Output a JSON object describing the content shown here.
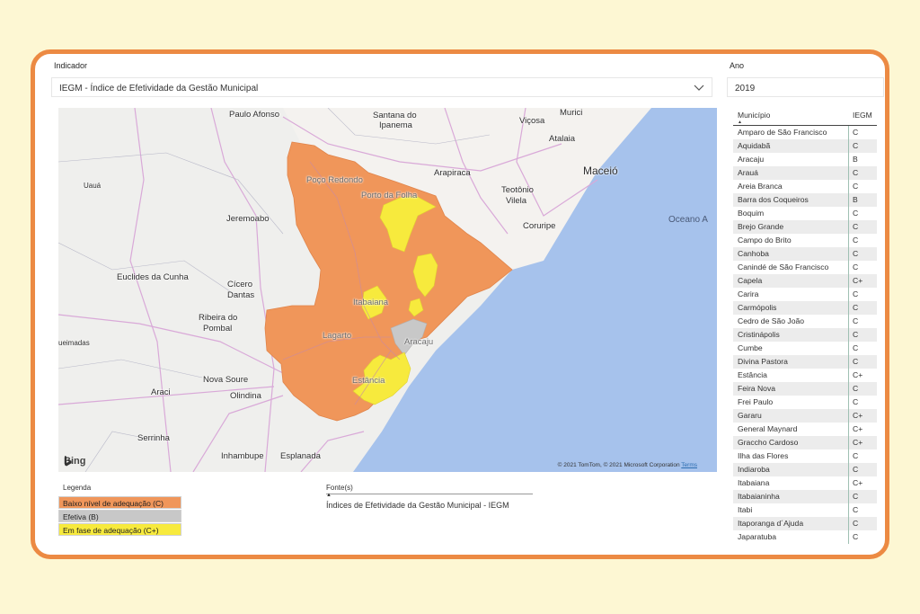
{
  "filters": {
    "indicator_label": "Indicador",
    "indicator_value": "IEGM - Índice de Efetividade da Gestão Municipal",
    "year_label": "Ano",
    "year_value": "2019"
  },
  "map": {
    "places": [
      {
        "id": "paulo-afonso",
        "text": "Paulo Afonso"
      },
      {
        "id": "santana",
        "text": "Santana do"
      },
      {
        "id": "ipanema",
        "text": "Ipanema"
      },
      {
        "id": "vicosa",
        "text": "Viçosa"
      },
      {
        "id": "murici",
        "text": "Murici"
      },
      {
        "id": "atalaia",
        "text": "Atalaia"
      },
      {
        "id": "maceio",
        "text": "Maceió"
      },
      {
        "id": "arapiraca",
        "text": "Arapiraca"
      },
      {
        "id": "teotonio",
        "text": "Teotônio"
      },
      {
        "id": "vilela",
        "text": "Vilela"
      },
      {
        "id": "coruripe",
        "text": "Coruripe"
      },
      {
        "id": "oceano",
        "text": "Oceano A"
      },
      {
        "id": "uaua",
        "text": "Uauá"
      },
      {
        "id": "jeremoabo",
        "text": "Jeremoabo"
      },
      {
        "id": "poco-redondo",
        "text": "Poço Redondo"
      },
      {
        "id": "porto-da-folha",
        "text": "Porto da Folha"
      },
      {
        "id": "euclides",
        "text": "Euclides da Cunha"
      },
      {
        "id": "cicero",
        "text": "Cícero"
      },
      {
        "id": "dantas",
        "text": "Dantas"
      },
      {
        "id": "ribeira",
        "text": "Ribeira do"
      },
      {
        "id": "pombal",
        "text": "Pombal"
      },
      {
        "id": "queimadas",
        "text": "ueimadas"
      },
      {
        "id": "itabaiana",
        "text": "Itabaiana"
      },
      {
        "id": "lagarto",
        "text": "Lagarto"
      },
      {
        "id": "aracaju",
        "text": "Aracaju"
      },
      {
        "id": "nova-soure",
        "text": "Nova Soure"
      },
      {
        "id": "araci",
        "text": "Araci"
      },
      {
        "id": "olindina",
        "text": "Olindina"
      },
      {
        "id": "estancia",
        "text": "Estância"
      },
      {
        "id": "serrinha",
        "text": "Serrinha"
      },
      {
        "id": "inhambupe",
        "text": "Inhambupe"
      },
      {
        "id": "esplanada",
        "text": "Esplanada"
      }
    ],
    "bing_label": "Bing",
    "attribution": "© 2021 TomTom, © 2021 Microsoft Corporation",
    "terms": "Terms",
    "colors": {
      "low": "#f0965a",
      "effective": "#c8c8c8",
      "adapting": "#f7ea3d",
      "sea": "#a6c2ec",
      "land": "#efefed"
    }
  },
  "legend": {
    "title": "Legenda",
    "items": [
      {
        "label": "Baixo nível de adequação (C)",
        "color": "#f0965a"
      },
      {
        "label": "Efetiva (B)",
        "color": "#c8c8c8"
      },
      {
        "label": "Em fase de adequação (C+)",
        "color": "#f7ea3d"
      }
    ]
  },
  "source": {
    "title": "Fonte(s)",
    "text": "Índices de Efetividade da Gestão Municipal - IEGM"
  },
  "table": {
    "headers": [
      "Município",
      "IEGM"
    ],
    "rows": [
      [
        "Amparo de São Francisco",
        "C"
      ],
      [
        "Aquidabã",
        "C"
      ],
      [
        "Aracaju",
        "B"
      ],
      [
        "Arauá",
        "C"
      ],
      [
        "Areia Branca",
        "C"
      ],
      [
        "Barra dos Coqueiros",
        "B"
      ],
      [
        "Boquim",
        "C"
      ],
      [
        "Brejo Grande",
        "C"
      ],
      [
        "Campo do Brito",
        "C"
      ],
      [
        "Canhoba",
        "C"
      ],
      [
        "Canindé de São Francisco",
        "C"
      ],
      [
        "Capela",
        "C+"
      ],
      [
        "Carira",
        "C"
      ],
      [
        "Carmópolis",
        "C"
      ],
      [
        "Cedro de São João",
        "C"
      ],
      [
        "Cristinápolis",
        "C"
      ],
      [
        "Cumbe",
        "C"
      ],
      [
        "Divina Pastora",
        "C"
      ],
      [
        "Estância",
        "C+"
      ],
      [
        "Feira Nova",
        "C"
      ],
      [
        "Frei Paulo",
        "C"
      ],
      [
        "Gararu",
        "C+"
      ],
      [
        "General Maynard",
        "C+"
      ],
      [
        "Graccho Cardoso",
        "C+"
      ],
      [
        "Ilha das Flores",
        "C"
      ],
      [
        "Indiaroba",
        "C"
      ],
      [
        "Itabaiana",
        "C+"
      ],
      [
        "Itabaianinha",
        "C"
      ],
      [
        "Itabi",
        "C"
      ],
      [
        "Itaporanga d´Ajuda",
        "C"
      ],
      [
        "Japaratuba",
        "C"
      ]
    ]
  }
}
